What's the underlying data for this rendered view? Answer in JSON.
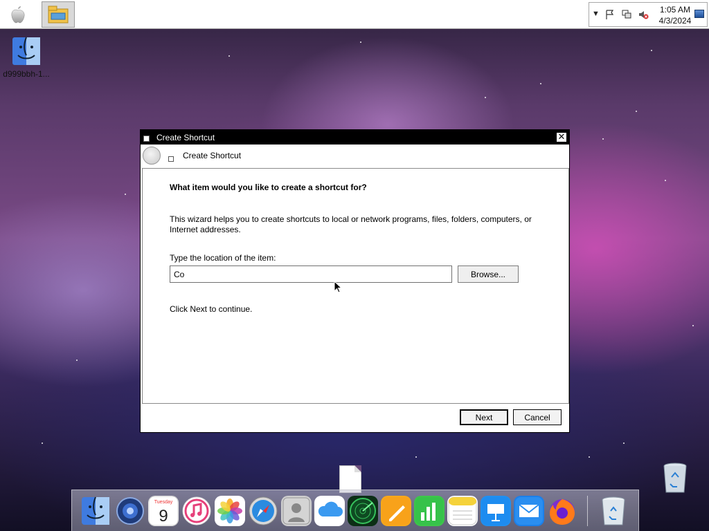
{
  "taskbar": {
    "clock_time": "1:05 AM",
    "clock_date": "4/3/2024"
  },
  "desktop": {
    "icons": [
      {
        "label": "d999bbh-1..."
      }
    ]
  },
  "dialog": {
    "window_title": "Create Shortcut",
    "close_glyph": "✕",
    "header_title": "Create Shortcut",
    "question": "What item would you like to create a shortcut for?",
    "description": "This wizard helps you to create shortcuts to local or network programs, files, folders, computers, or Internet addresses.",
    "location_label": "Type the location of the item:",
    "location_value": "Co",
    "browse_label": "Browse...",
    "continue_text": "Click Next to continue.",
    "next_label": "Next",
    "cancel_label": "Cancel"
  },
  "dock": {
    "calendar_day": "9",
    "calendar_month": "Tuesday",
    "items": [
      "finder",
      "launchpad",
      "calendar",
      "itunes",
      "photos",
      "safari",
      "contacts",
      "icloud",
      "radar",
      "pages",
      "numbers",
      "notes",
      "keynote",
      "mail",
      "firefox",
      "trash"
    ]
  },
  "colors": {
    "titlebar": "#000000",
    "accent_blue": "#2a6fd6"
  }
}
